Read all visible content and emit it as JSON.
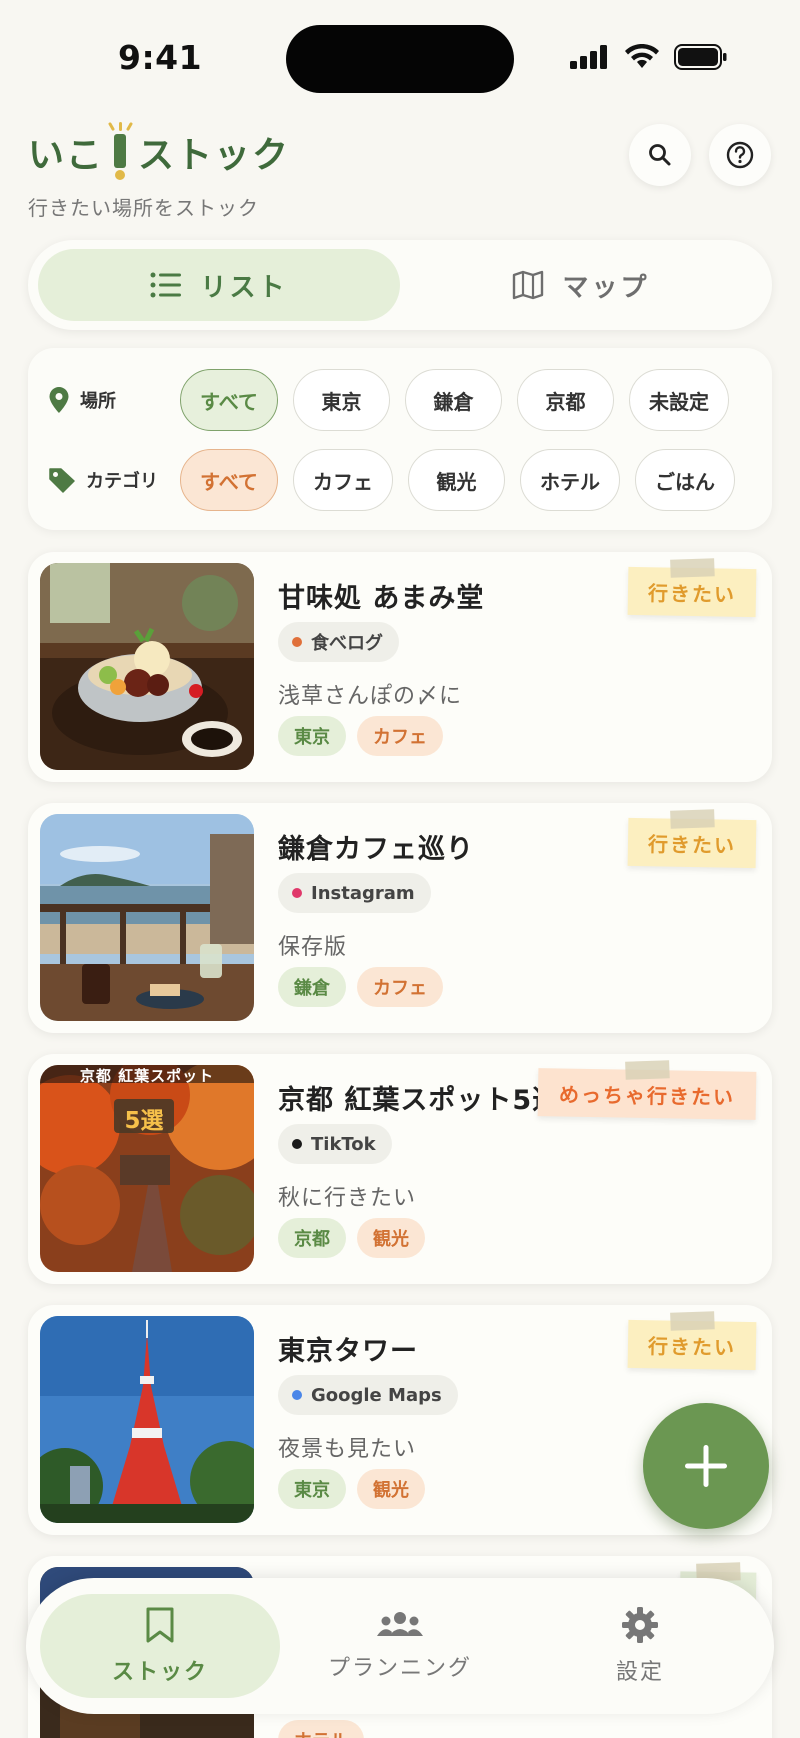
{
  "status_bar": {
    "time": "9:41"
  },
  "header": {
    "title_part1": "いこ",
    "title_part2": "ストック",
    "subtitle": "行きたい場所をストック"
  },
  "view_toggle": {
    "list_label": "リスト",
    "map_label": "マップ",
    "selected": "list"
  },
  "filters": {
    "location": {
      "label": "場所",
      "options": [
        "すべて",
        "東京",
        "鎌倉",
        "京都",
        "未設定"
      ],
      "selected": "すべて"
    },
    "category": {
      "label": "カテゴリ",
      "options": [
        "すべて",
        "カフェ",
        "観光",
        "ホテル",
        "ごはん"
      ],
      "selected": "すべて"
    }
  },
  "cards": [
    {
      "title": "甘味処 あまみ堂",
      "source": "食べログ",
      "source_color": "#e0703a",
      "memo": "浅草さんぽの〆に",
      "tags": [
        "東京",
        "カフェ"
      ],
      "status": "行きたい",
      "status_style": "yellow"
    },
    {
      "title": "鎌倉カフェ巡り",
      "source": "Instagram",
      "source_color": "#e0386a",
      "memo": "保存版",
      "tags": [
        "鎌倉",
        "カフェ"
      ],
      "status": "行きたい",
      "status_style": "yellow"
    },
    {
      "title": "京都 紅葉スポット5選",
      "source": "TikTok",
      "source_color": "#1a1a1a",
      "memo": "秋に行きたい",
      "tags": [
        "京都",
        "観光"
      ],
      "status": "めっちゃ行きたい",
      "status_style": "peach",
      "thumb_caption": "京都 紅葉スポット",
      "thumb_badge": "5選"
    },
    {
      "title": "東京タワー",
      "source": "Google Maps",
      "source_color": "#4a86e8",
      "memo": "夜景も見たい",
      "tags": [
        "東京",
        "観光"
      ],
      "status": "行きたい",
      "status_style": "yellow"
    },
    {
      "title": "",
      "source": "",
      "memo": "",
      "tags": [
        "ホテル"
      ],
      "status": "",
      "status_style": "green"
    }
  ],
  "fab": {
    "icon": "plus-icon"
  },
  "bottom_nav": {
    "items": [
      {
        "label": "ストック",
        "icon": "bookmark-icon"
      },
      {
        "label": "プランニング",
        "icon": "people-icon"
      },
      {
        "label": "設定",
        "icon": "gear-icon"
      }
    ],
    "selected": "ストック"
  },
  "colors": {
    "accent_green": "#6b9752",
    "chip_green_bg": "#e5efd9",
    "chip_orange_bg": "#fbe6d4",
    "background": "#f8f7f2"
  }
}
